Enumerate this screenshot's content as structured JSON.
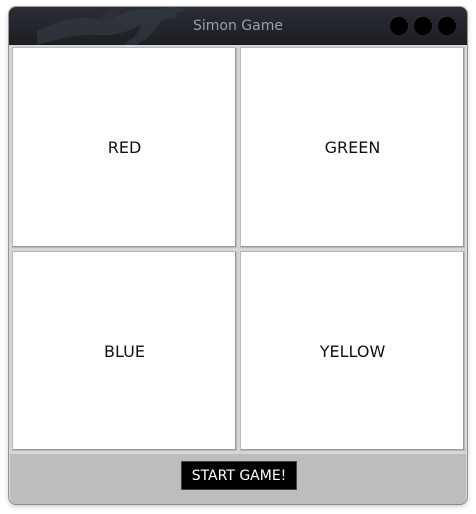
{
  "window": {
    "title": "Simon Game"
  },
  "buttons": {
    "red": "RED",
    "green": "GREEN",
    "blue": "BLUE",
    "yellow": "YELLOW"
  },
  "controls": {
    "start_label": "START GAME!"
  },
  "colors": {
    "titlebar": "#1f2126",
    "title_text": "#9a9ea6",
    "button_face": "#ffffff",
    "bottom_bar": "#bdbdbd",
    "start_button": "#000000"
  },
  "icons": {
    "titlebar_decoration": "dragon-icon",
    "window_controls": [
      "window-control-1-icon",
      "window-control-2-icon",
      "window-control-3-icon"
    ]
  }
}
